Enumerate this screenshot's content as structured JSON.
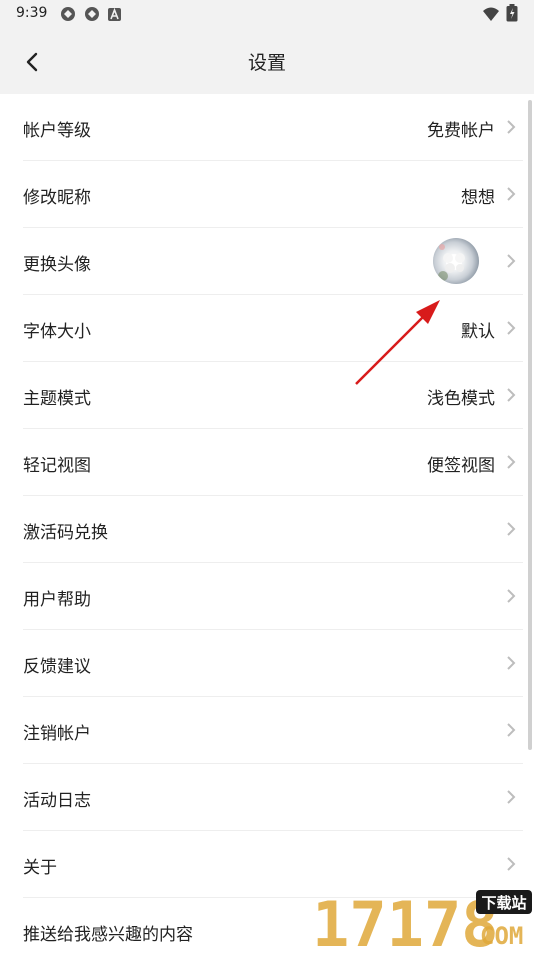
{
  "status_bar": {
    "time": "9:39"
  },
  "header": {
    "title": "设置",
    "back_icon": "chevron-left-icon"
  },
  "settings": [
    {
      "label": "帐户等级",
      "value": "免费帐户"
    },
    {
      "label": "修改昵称",
      "value": "想想"
    },
    {
      "label": "更换头像",
      "value": "",
      "avatar": true
    },
    {
      "label": "字体大小",
      "value": "默认"
    },
    {
      "label": "主题模式",
      "value": "浅色模式"
    },
    {
      "label": "轻记视图",
      "value": "便签视图"
    },
    {
      "label": "激活码兑换",
      "value": ""
    },
    {
      "label": "用户帮助",
      "value": ""
    },
    {
      "label": "反馈建议",
      "value": ""
    },
    {
      "label": "注销帐户",
      "value": ""
    },
    {
      "label": "活动日志",
      "value": ""
    },
    {
      "label": "关于",
      "value": ""
    },
    {
      "label": "推送给我感兴趣的内容",
      "value": ""
    }
  ],
  "watermark": {
    "digits": "17178",
    "domain": "COM",
    "badge": "下载站"
  },
  "colors": {
    "annotation_arrow": "#d81b1b",
    "watermark_gold": "#e0a93a",
    "badge_bg": "#1a1a1a"
  }
}
